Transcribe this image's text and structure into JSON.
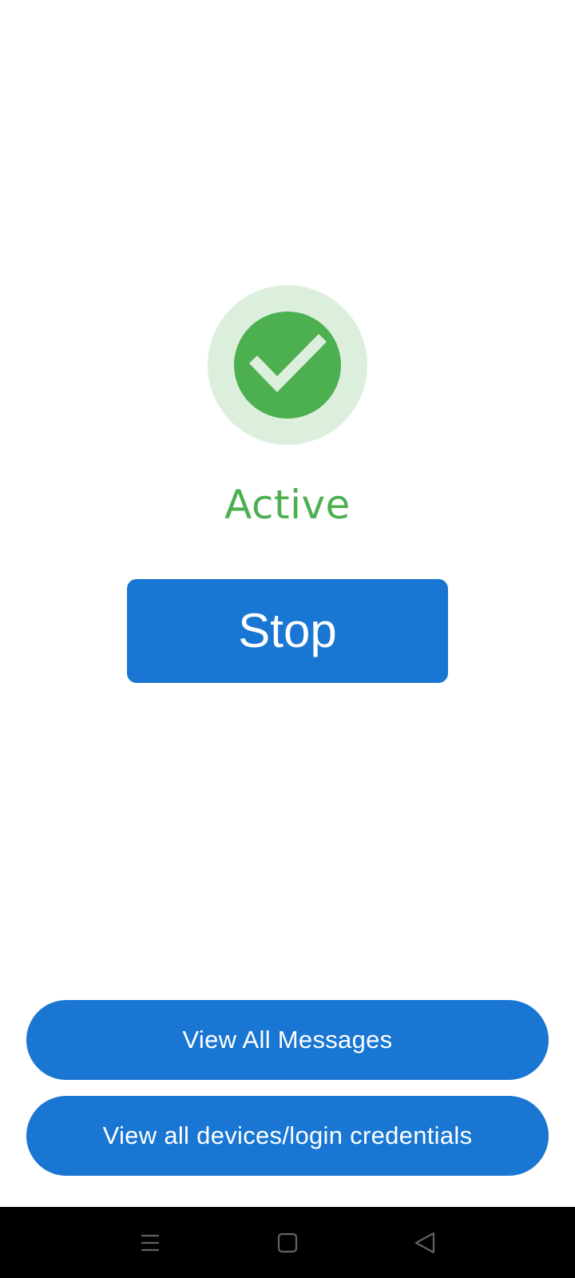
{
  "status": {
    "label": "Active",
    "icon": "check-circle-icon",
    "color": "#4caf50",
    "ring_color": "#dcefdd"
  },
  "actions": {
    "stop_label": "Stop",
    "view_messages_label": "View All Messages",
    "view_devices_label": "View all devices/login credentials",
    "button_color": "#1976d2"
  },
  "nav_bar": {
    "items": [
      {
        "icon": "menu-icon"
      },
      {
        "icon": "home-square-icon"
      },
      {
        "icon": "back-triangle-icon"
      }
    ]
  }
}
